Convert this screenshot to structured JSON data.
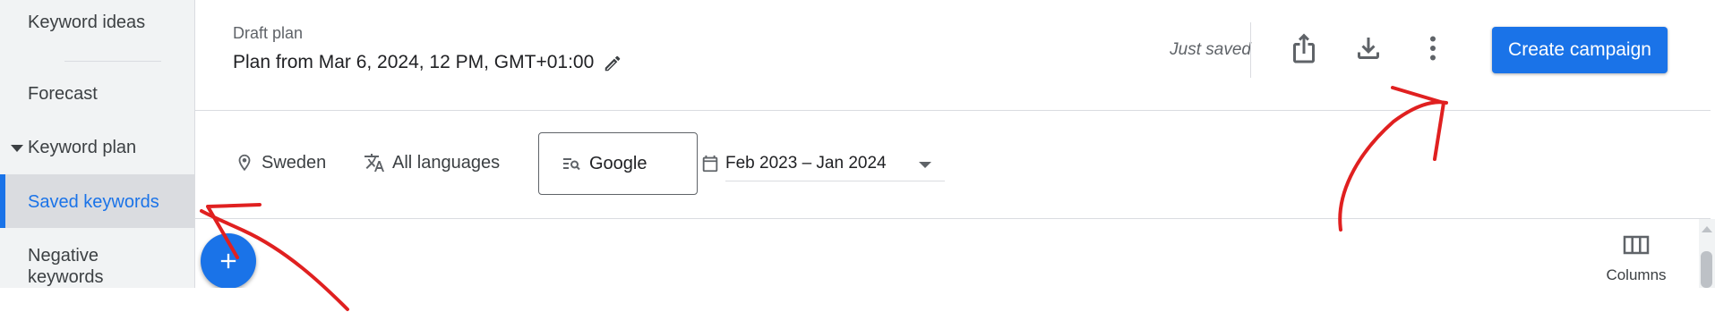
{
  "sidebar": {
    "items": [
      {
        "label": "Keyword ideas"
      },
      {
        "label": "Forecast"
      },
      {
        "label": "Keyword plan"
      },
      {
        "label": "Saved keywords"
      },
      {
        "label": "Negative keywords"
      }
    ]
  },
  "header": {
    "draft_label": "Draft plan",
    "plan_title": "Plan from Mar 6, 2024, 12 PM, GMT+01:00",
    "save_status": "Just saved",
    "create_button": "Create campaign",
    "icons": [
      "share-icon",
      "download-icon",
      "more-vert-icon",
      "edit-pencil-icon"
    ]
  },
  "filters": {
    "location": "Sweden",
    "language": "All languages",
    "network": "Google",
    "date_range": "Feb 2023 – Jan 2024"
  },
  "toolbar": {
    "columns_label": "Columns"
  },
  "colors": {
    "accent": "#1a73e8",
    "annotation": "#e02020",
    "sidebar_bg": "#f1f3f4"
  }
}
